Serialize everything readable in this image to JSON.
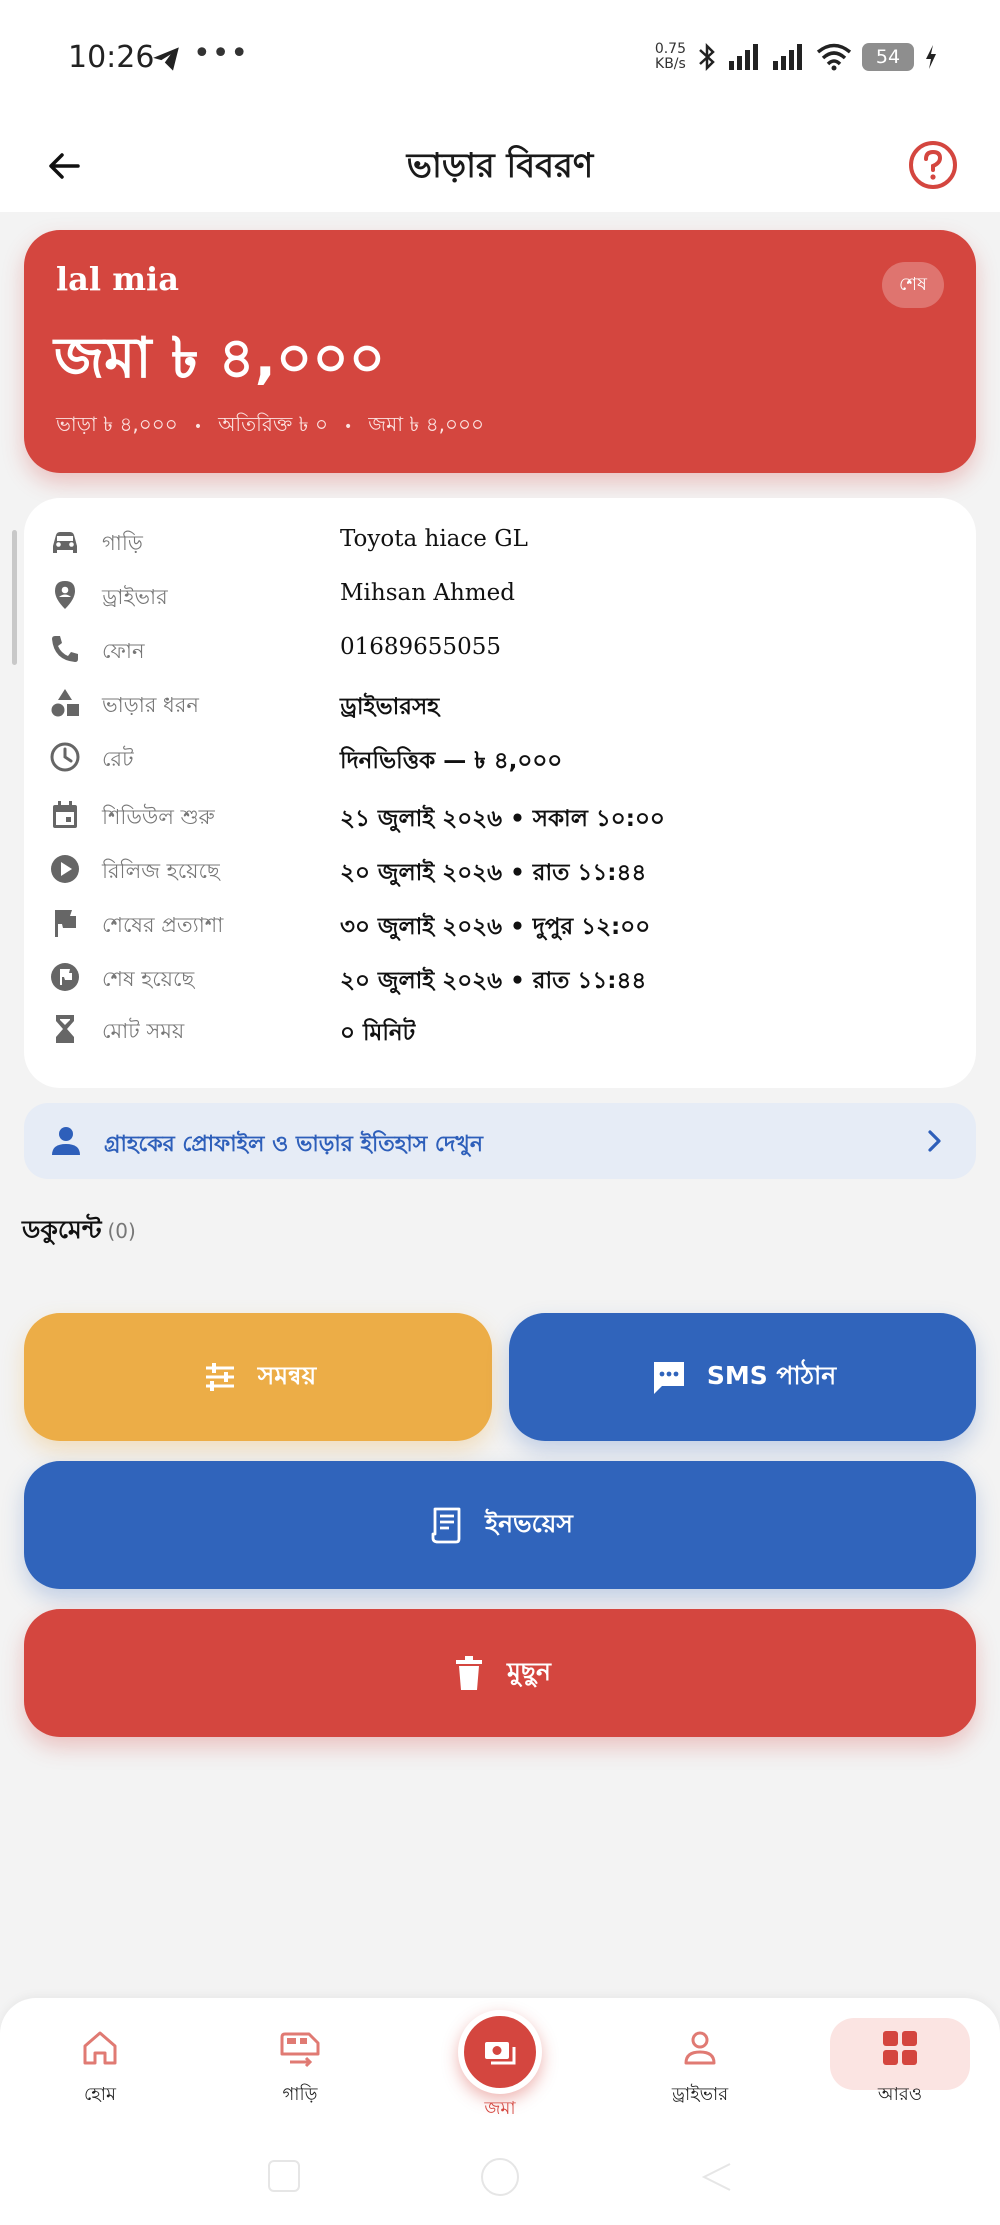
{
  "status_bar": {
    "time": "10:26",
    "dots": "•••",
    "speed_top": "0.75",
    "speed_bottom": "KB/s",
    "battery": "54"
  },
  "app_bar": {
    "title": "ভাড়ার বিবরণ",
    "back_icon": "arrow-left-icon",
    "help_icon": "help-circle-icon"
  },
  "hero": {
    "name": "lal mia",
    "badge": "শেষ",
    "amount": "জমা ৳ ৪,০০০",
    "breakdown": {
      "fare": "ভাড়া ৳ ৪,০০০",
      "extra": "অতিরিক্ত ৳ ০",
      "deposit": "জমা ৳ ৪,০০০",
      "sep": "•"
    },
    "color": "#d4463f"
  },
  "details": {
    "rows": [
      {
        "icon": "car-icon",
        "label": "গাড়ি",
        "value": "Toyota hiace GL"
      },
      {
        "icon": "location-pin-icon",
        "label": "ড্রাইভার",
        "value": "Mihsan Ahmed"
      },
      {
        "icon": "phone-icon",
        "label": "ফোন",
        "value": "01689655055"
      },
      {
        "icon": "shapes-icon",
        "label": "ভাড়ার ধরন",
        "value": "ড্রাইভারসহ"
      },
      {
        "icon": "clock-icon",
        "label": "রেট",
        "value": "দিনভিত্তিক — ৳ ৪,০০০"
      },
      {
        "icon": "calendar-icon",
        "label": "শিডিউল শুরু",
        "value": "২১ জুলাই ২০২৬ • সকাল ১০:০০"
      },
      {
        "icon": "play-circle-icon",
        "label": "রিলিজ হয়েছে",
        "value": "২০ জুলাই ২০২৬ • রাত ১১:৪৪"
      },
      {
        "icon": "flag-icon",
        "label": "শেষের প্রত্যাশা",
        "value": "৩০ জুলাই ২০২৬ • দুপুর ১২:০০"
      },
      {
        "icon": "flag-circle-icon",
        "label": "শেষ হয়েছে",
        "value": "২০ জুলাই ২০২৬ • রাত ১১:৪৪"
      },
      {
        "icon": "hourglass-icon",
        "label": "মোট সময়",
        "value": "০ মিনিট"
      }
    ]
  },
  "customer_link": {
    "text": "গ্রাহকের প্রোফাইল ও ভাড়ার ইতিহাস দেখুন",
    "icon": "person-icon",
    "chevron": "chevron-right-icon"
  },
  "documents": {
    "heading": "ডকুমেন্ট",
    "count": "(0)"
  },
  "actions": {
    "adjust": "সমন্বয়",
    "sms": "SMS পাঠান",
    "invoice": "ইনভয়েস",
    "delete": "মুছুন"
  },
  "bottom_nav": {
    "home": "হোম",
    "car": "গাড়ি",
    "deposit": "জমা",
    "driver": "ড্রাইভার",
    "more": "আরও"
  },
  "colors": {
    "accent_red": "#d4463f",
    "accent_blue": "#3064bb",
    "accent_orange": "#ecad47",
    "link_bg": "#e6ecf6"
  }
}
